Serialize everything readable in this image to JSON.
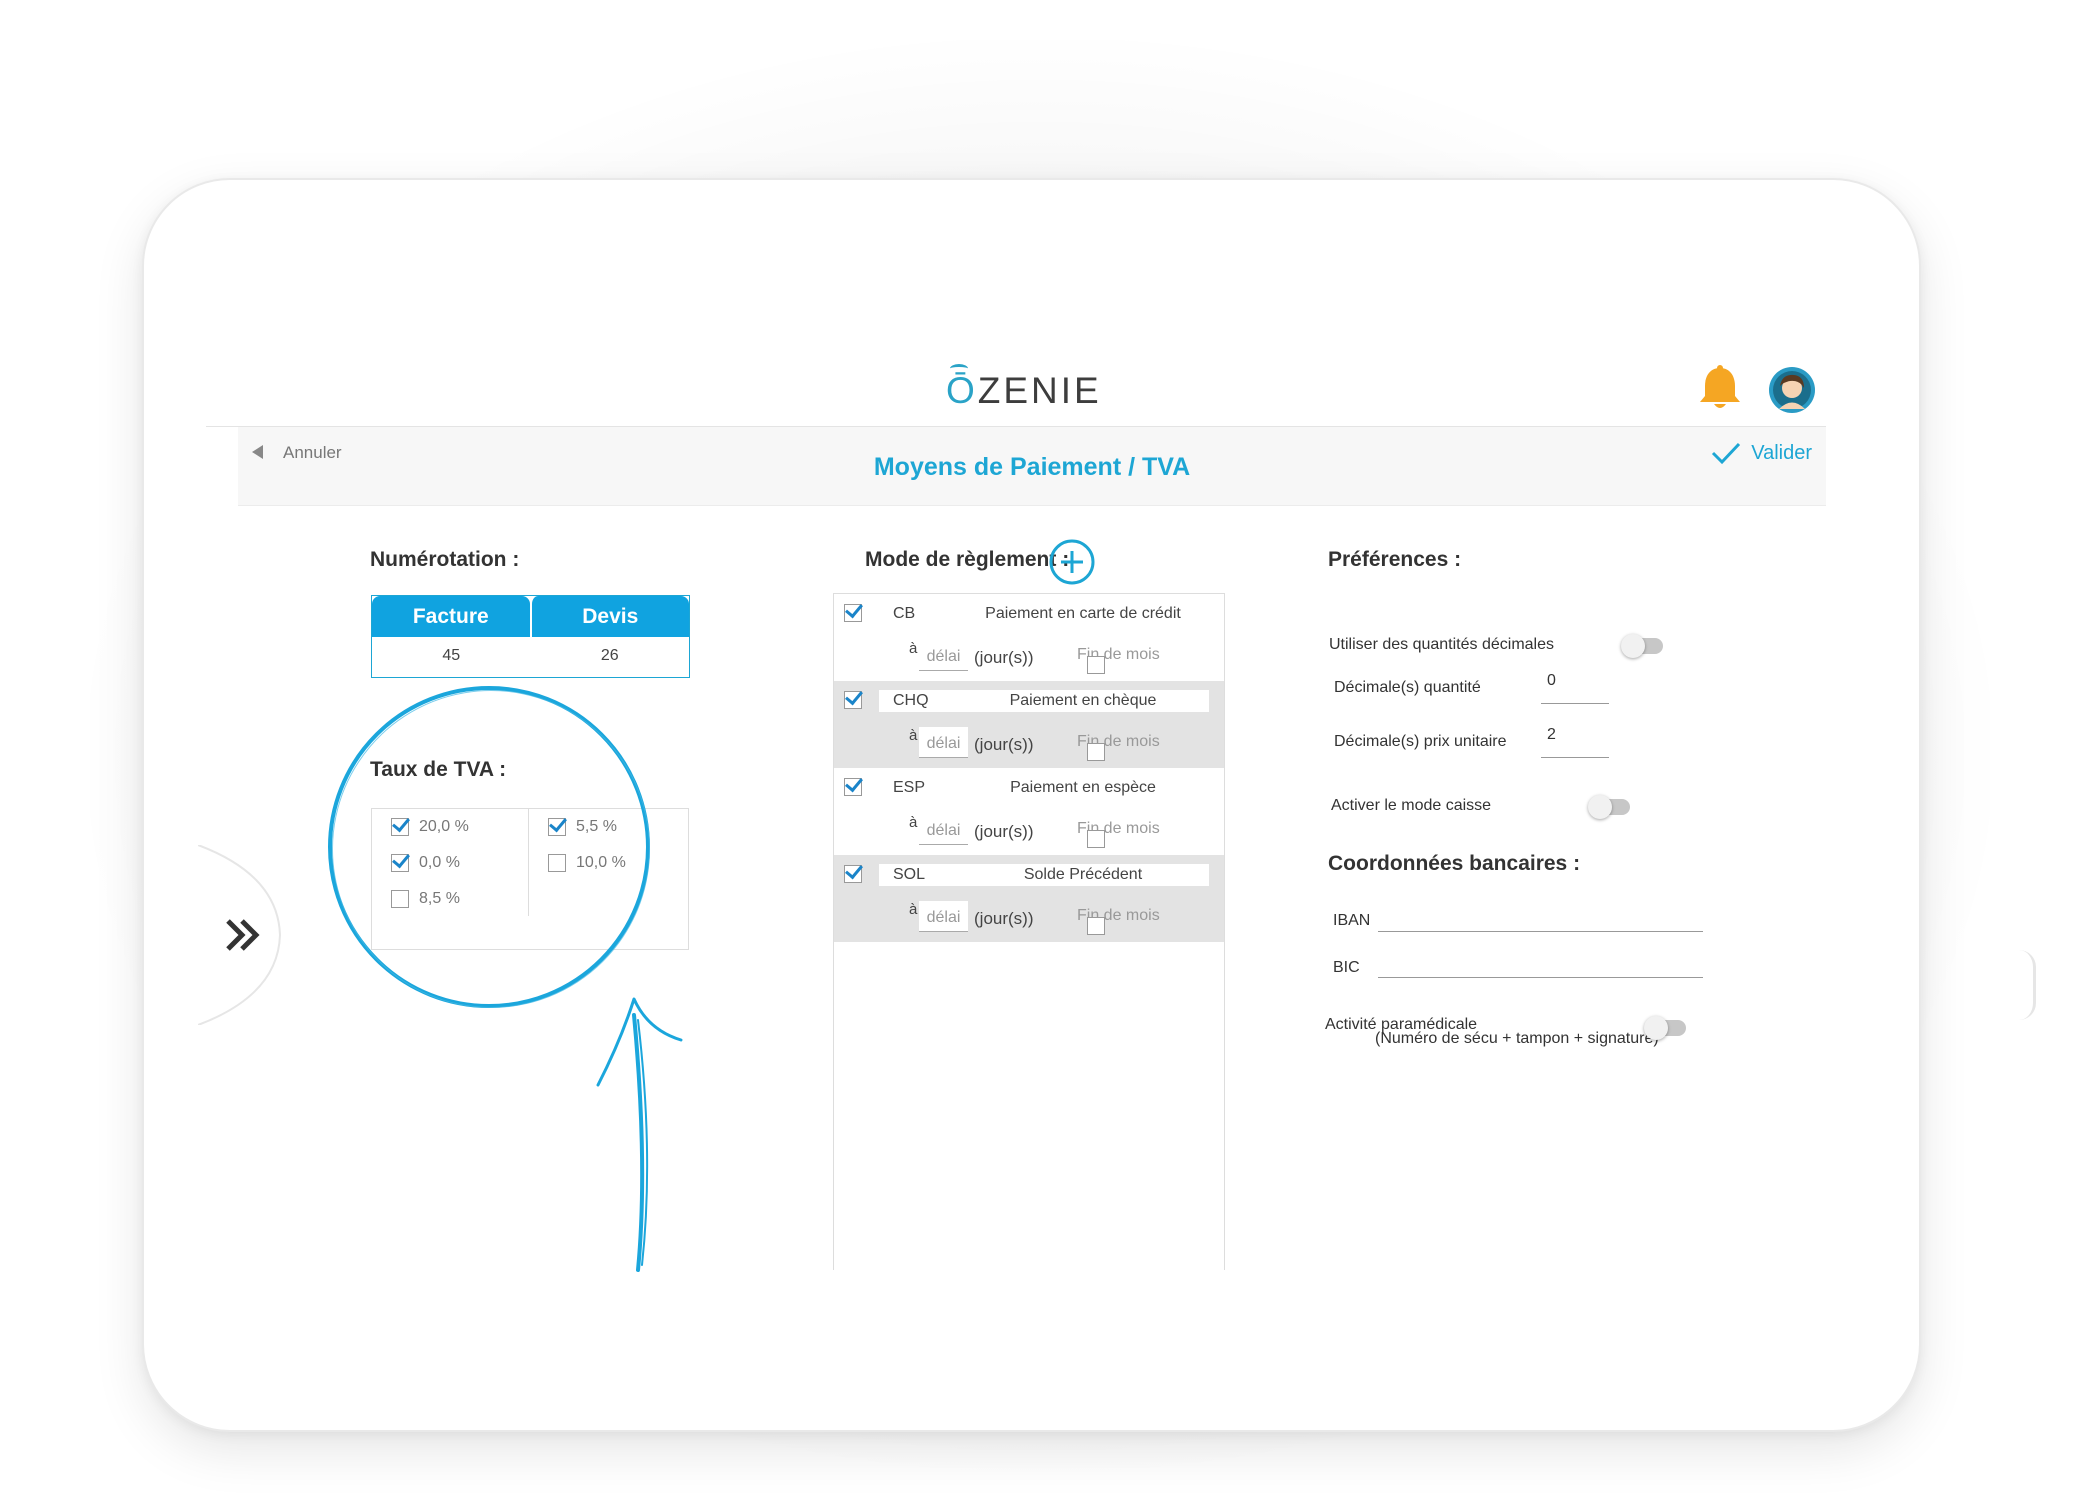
{
  "app": {
    "logo": "ŌZENIE",
    "logo_o": "Ō",
    "logo_rest": "ZENIE"
  },
  "header": {
    "cancel_label": "Annuler",
    "title": "Moyens de Paiement / TVA",
    "validate_label": "Valider"
  },
  "numerotation": {
    "title": "Numérotation :",
    "tabs": [
      {
        "label": "Facture",
        "value": "45"
      },
      {
        "label": "Devis",
        "value": "26"
      }
    ]
  },
  "tva": {
    "title": "Taux de TVA :",
    "items": [
      {
        "label": "20,0 %",
        "checked": true
      },
      {
        "label": "0,0 %",
        "checked": true
      },
      {
        "label": "8,5 %",
        "checked": false
      },
      {
        "label": "5,5 %",
        "checked": true
      },
      {
        "label": "10,0 %",
        "checked": false
      }
    ]
  },
  "mode_reglement": {
    "title": "Mode de règlement :",
    "a_label": "à",
    "delai_placeholder": "délai",
    "jours_label": "(jour(s))",
    "fin_de_mois_label": "Fin de mois",
    "rows": [
      {
        "code": "CB",
        "label": "Paiement en carte de crédit",
        "checked": true
      },
      {
        "code": "CHQ",
        "label": "Paiement en chèque",
        "checked": true
      },
      {
        "code": "ESP",
        "label": "Paiement en espèce",
        "checked": true
      },
      {
        "code": "SOL",
        "label": "Solde Précédent",
        "checked": true
      }
    ]
  },
  "preferences": {
    "title": "Préférences :",
    "decimal_quantities_label": "Utiliser des quantités décimales",
    "decimal_quantity_label": "Décimale(s) quantité",
    "decimal_quantity_value": "0",
    "decimal_price_label": "Décimale(s) prix unitaire",
    "decimal_price_value": "2",
    "cash_mode_label": "Activer le mode caisse",
    "bank_title": "Coordonnées bancaires :",
    "iban_label": "IBAN",
    "iban_value": "",
    "bic_label": "BIC",
    "bic_value": "",
    "paramedical_label": "Activité paramédicale",
    "paramedical_sub": "(Numéro de sécu + tampon + signature)"
  },
  "colors": {
    "accent": "#1da6d4",
    "tab_blue": "#10a3e0",
    "bell": "#f5a623",
    "row_alt": "#e3e3e3"
  },
  "icons": [
    "bell-icon",
    "avatar-icon",
    "back-arrow-icon",
    "check-icon",
    "plus-circle-icon",
    "double-chevron-right-icon"
  ]
}
